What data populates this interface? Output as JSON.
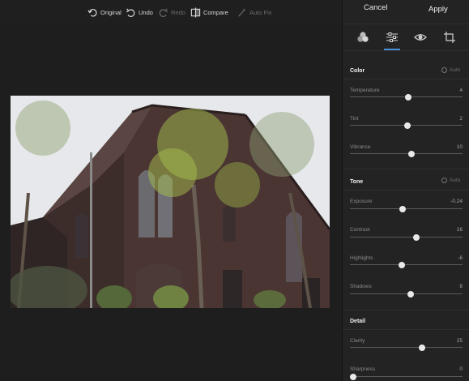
{
  "toolbar": {
    "original": "Original",
    "undo": "Undo",
    "redo": "Redo",
    "compare": "Compare",
    "auto_fix": "Auto Fix"
  },
  "panel": {
    "cancel": "Cancel",
    "apply": "Apply",
    "tabs": [
      "filters-icon",
      "adjust-icon",
      "eye-icon",
      "crop-icon"
    ],
    "active_tab": "adjust-icon",
    "accent_color": "#4a90d9"
  },
  "sections": {
    "color": {
      "title": "Color",
      "auto": "Auto",
      "sliders": [
        {
          "label": "Temperature",
          "value": "4",
          "level": 0.52
        },
        {
          "label": "Tint",
          "value": "2",
          "level": 0.51
        },
        {
          "label": "Vibrance",
          "value": "10",
          "level": 0.55
        }
      ]
    },
    "tone": {
      "title": "Tone",
      "auto": "Auto",
      "sliders": [
        {
          "label": "Exposure",
          "value": "-0.24",
          "level": 0.47
        },
        {
          "label": "Contrast",
          "value": "16",
          "level": 0.59
        },
        {
          "label": "Highlights",
          "value": "-6",
          "level": 0.46
        },
        {
          "label": "Shadows",
          "value": "8",
          "level": 0.54
        }
      ]
    },
    "detail": {
      "title": "Detail",
      "sliders": [
        {
          "label": "Clarity",
          "value": "25",
          "level": 0.64
        },
        {
          "label": "Sharpness",
          "value": "0",
          "level": 0.0
        }
      ]
    }
  }
}
